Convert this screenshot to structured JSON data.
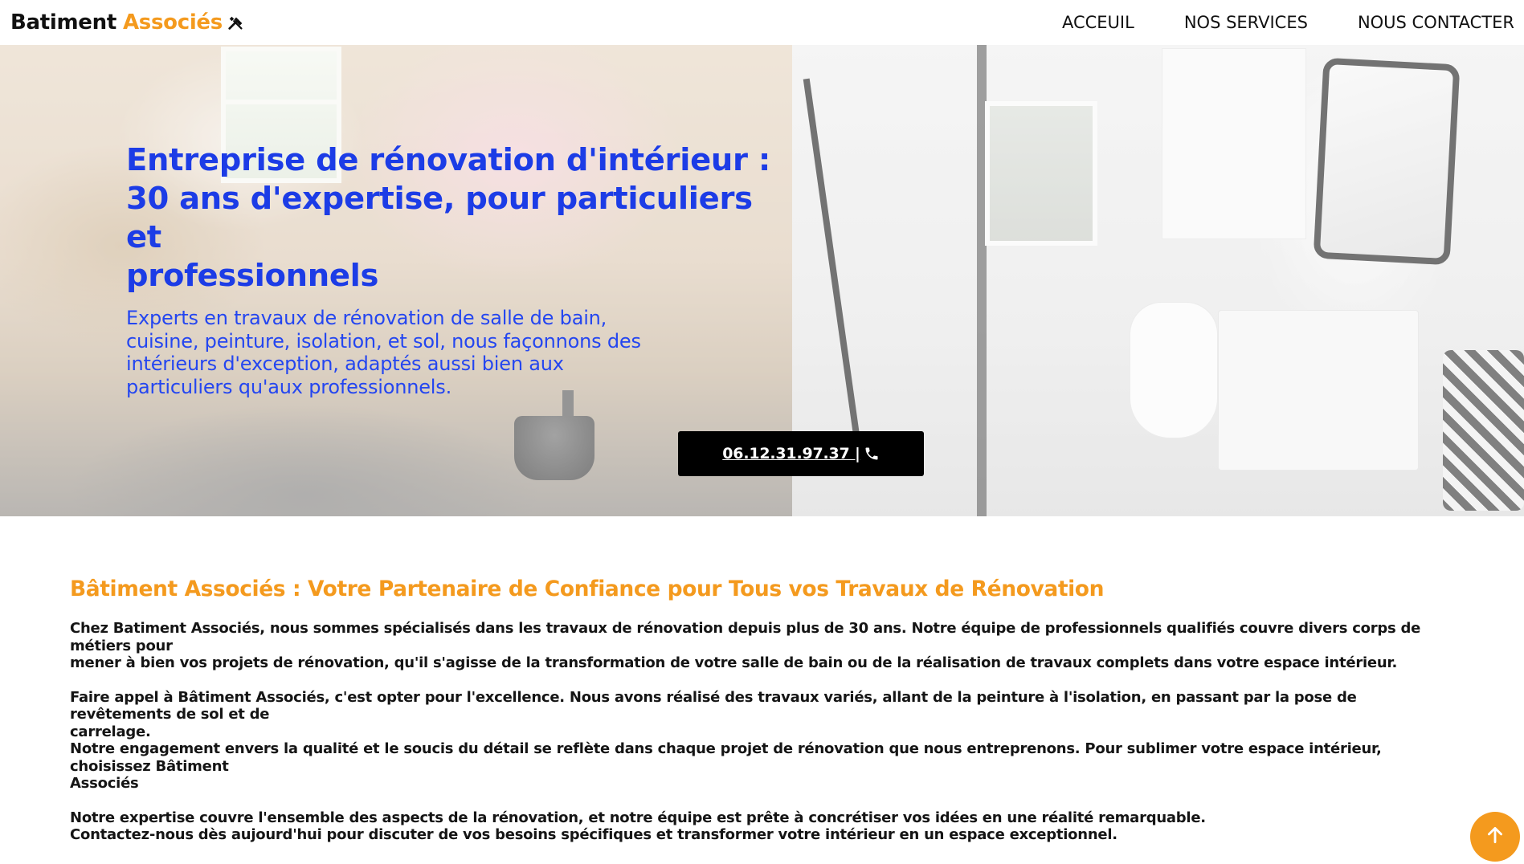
{
  "logo": {
    "part1": "Batiment",
    "part2": "Associés",
    "icon": "tools-icon"
  },
  "nav": {
    "items": [
      {
        "label": "ACCEUIL"
      },
      {
        "label": "NOS SERVICES"
      },
      {
        "label": "NOUS CONTACTER"
      }
    ]
  },
  "hero": {
    "title_lines": [
      "Entreprise de rénovation d'intérieur :",
      "30 ans d'expertise, pour particuliers et",
      "professionnels"
    ],
    "subtitle_lines": [
      "Experts en travaux de rénovation de salle de bain,",
      "cuisine, peinture, isolation, et sol, nous façonnons des",
      "intérieurs d'exception, adaptés aussi bien aux",
      "particuliers qu'aux professionnels."
    ],
    "phone_label": "06.12.31.97.37 |",
    "phone_icon": "phone-icon"
  },
  "section": {
    "title": "Bâtiment Associés : Votre Partenaire de Confiance pour Tous vos Travaux de Rénovation",
    "paragraphs": [
      {
        "lines": [
          "Chez Batiment Associés, nous sommes spécialisés dans les travaux de rénovation depuis plus de 30 ans. Notre équipe de professionnels qualifiés couvre divers corps de métiers pour",
          "mener à bien vos projets de rénovation, qu'il s'agisse de la transformation de votre salle de bain ou de la réalisation de travaux complets dans votre espace intérieur."
        ]
      },
      {
        "lines": [
          "Faire appel à Bâtiment Associés, c'est opter pour l'excellence. Nous avons réalisé des travaux variés, allant de la peinture à l'isolation, en passant par la pose de revêtements de sol et de",
          "carrelage.",
          "Notre engagement envers la qualité et le soucis du détail se reflète dans chaque projet de rénovation que nous entreprenons. Pour sublimer votre espace intérieur, choisissez Bâtiment",
          "Associés"
        ]
      },
      {
        "lines": [
          "Notre expertise couvre l'ensemble des aspects de la rénovation, et notre équipe est prête à concrétiser vos idées en une réalité remarquable.",
          "Contactez-nous dès aujourd'hui pour discuter de vos besoins spécifiques et transformer votre intérieur en un espace exceptionnel."
        ]
      }
    ]
  },
  "scroll_top": {
    "icon": "arrow-up-icon"
  },
  "colors": {
    "accent": "#f49a1e",
    "hero_text": "#1c3ce6",
    "button_bg": "#000000"
  }
}
